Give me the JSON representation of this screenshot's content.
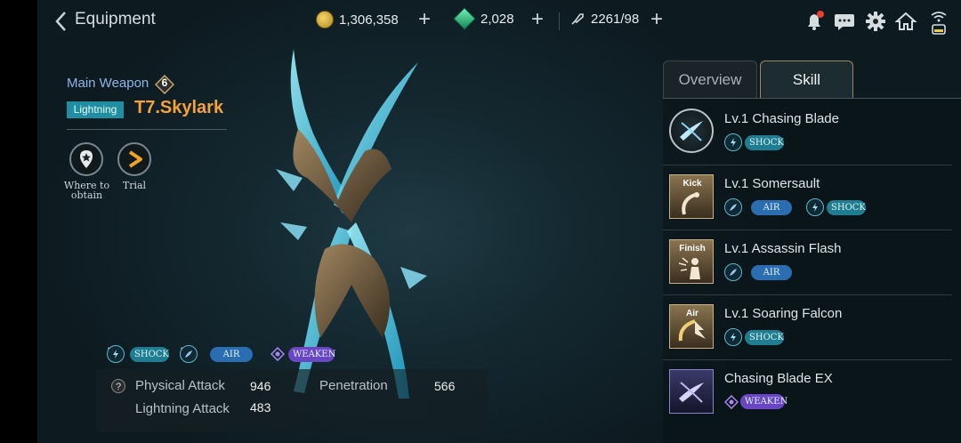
{
  "header": {
    "back_icon": "chevron-left-icon",
    "title": "Equipment",
    "gold": "1,306,358",
    "gems": "2,028",
    "stamina": "2261/98",
    "plus": "+"
  },
  "weapon": {
    "slot_label": "Main Weapon",
    "tier": "6",
    "element_tag": "Lightning",
    "name": "T7.Skylark",
    "where_to_obtain": [
      "Where to",
      "obtain"
    ],
    "trial": "Trial",
    "tags": [
      "SHOCK",
      "AIR",
      "WEAKEN"
    ]
  },
  "stats": [
    {
      "label": "Physical Attack",
      "value": "946"
    },
    {
      "label": "Penetration",
      "value": "566"
    },
    {
      "label": "Lightning Attack",
      "value": "483"
    }
  ],
  "tabs": {
    "overview": "Overview",
    "skill": "Skill",
    "selected": "Skill"
  },
  "skills": [
    {
      "level": "Lv.1",
      "name": "Chasing Blade",
      "icon_label": "",
      "tags": [
        "SHOCK"
      ]
    },
    {
      "level": "Lv.1",
      "name": "Somersault",
      "icon_label": "Kick",
      "tags": [
        "AIR",
        "SHOCK"
      ]
    },
    {
      "level": "Lv.1",
      "name": "Assassin Flash",
      "icon_label": "Finish",
      "tags": [
        "AIR"
      ]
    },
    {
      "level": "Lv.1",
      "name": "Soaring Falcon",
      "icon_label": "Air",
      "tags": [
        "SHOCK"
      ]
    },
    {
      "level": "",
      "name": "Chasing Blade EX",
      "icon_label": "",
      "tags": [
        "WEAKEN"
      ]
    }
  ],
  "colors": {
    "accent_orange": "#f5a23a",
    "shock_tag": "#1e7d90",
    "air_tag": "#2a6db0",
    "weaken_tag": "#6a46c4",
    "notification": "#e8402e"
  }
}
